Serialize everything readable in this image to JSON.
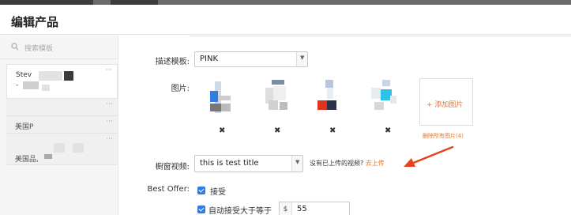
{
  "modal": {
    "title": "编辑产品"
  },
  "sidebar": {
    "search_placeholder": "搜索模板",
    "more_glyph": "···",
    "items": [
      {
        "label": "Stev",
        "sub": "-"
      },
      {
        "label": ""
      },
      {
        "label": "美国P"
      },
      {
        "label": "美国品,"
      }
    ]
  },
  "form": {
    "template_label": "描述模板:",
    "template_value": "PINK",
    "images_label": "图片:",
    "delete_glyph": "✖",
    "add_image_label": "+ 添加图片",
    "delete_all_label": "删除所有图片(4)",
    "video_label": "橱窗视频:",
    "video_value": "this is test title",
    "video_note": "没有已上传的视频?",
    "video_upload_link": "去上传",
    "best_offer_label": "Best Offer:",
    "accept_label": "接受",
    "auto_accept_label": "自动接受大于等于",
    "currency_symbol": "$",
    "auto_accept_value": "55"
  },
  "colors": {
    "accent_orange": "#e8762c",
    "checkbox_blue": "#2b7be8",
    "arrow_red": "#e8401c"
  },
  "icons": {
    "search": "search-icon",
    "dropdown": "chevron-down-icon",
    "remove": "close-icon",
    "more": "more-dots-icon"
  }
}
